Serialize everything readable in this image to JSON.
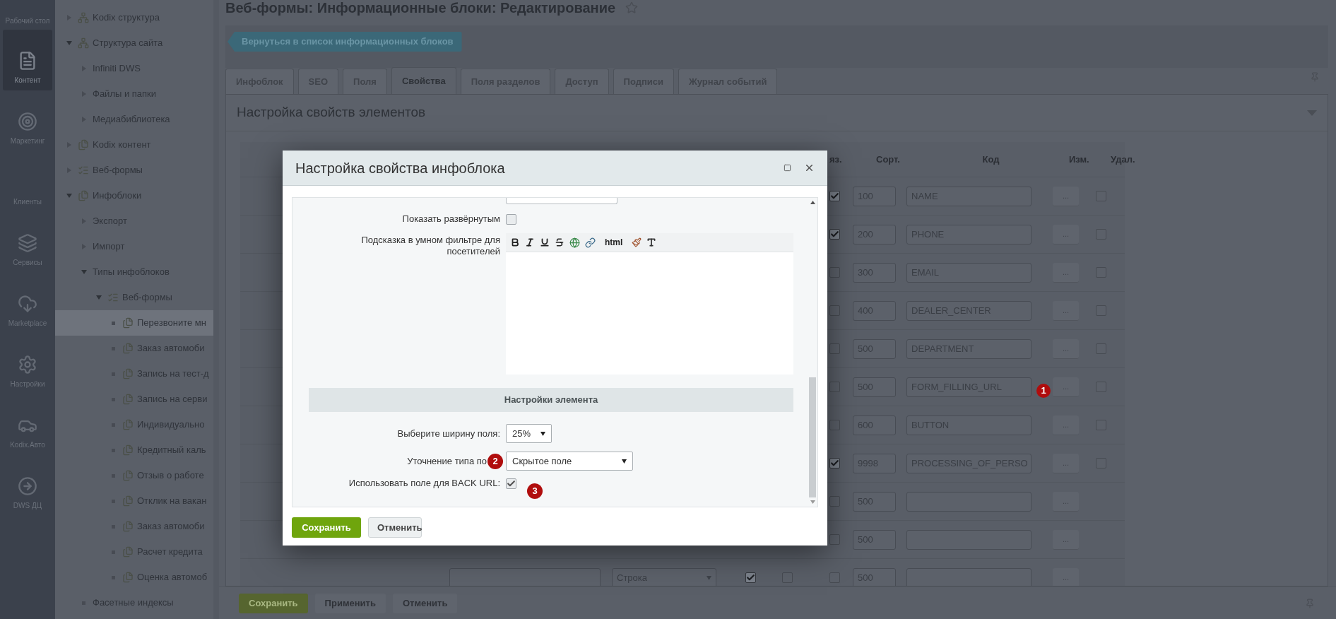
{
  "left_nav": [
    {
      "label": "Рабочий стол",
      "selected": false
    },
    {
      "label": "Контент",
      "selected": true
    },
    {
      "label": "Маркетинг",
      "selected": false
    },
    {
      "label": "Клиенты",
      "selected": false
    },
    {
      "label": "Сервисы",
      "selected": false
    },
    {
      "label": "Marketplace",
      "selected": false
    },
    {
      "label": "Настройки",
      "selected": false
    },
    {
      "label": "Kodix.Авто",
      "selected": false
    },
    {
      "label": "DWS ДЦ",
      "selected": false
    }
  ],
  "tree": [
    {
      "label": "Kodix структура",
      "kind": "branch",
      "expanded": false,
      "selected": false
    },
    {
      "label": "Структура сайта",
      "kind": "branch",
      "expanded": true,
      "selected": false,
      "children": [
        {
          "label": "Infiniti DWS",
          "kind": "branch",
          "expanded": false,
          "selected": false
        },
        {
          "label": "Файлы и папки",
          "kind": "branch",
          "expanded": false,
          "selected": false
        },
        {
          "label": "Медиабиблиотека",
          "kind": "branch",
          "expanded": false,
          "selected": false
        }
      ]
    },
    {
      "label": "Kodix контент",
      "kind": "branch",
      "expanded": false,
      "selected": false
    },
    {
      "label": "Веб-формы",
      "kind": "branch",
      "expanded": false,
      "selected": false
    },
    {
      "label": "Инфоблоки",
      "kind": "branch",
      "expanded": true,
      "selected": false,
      "children": [
        {
          "label": "Экспорт",
          "kind": "branch",
          "expanded": false,
          "selected": false
        },
        {
          "label": "Импорт",
          "kind": "branch",
          "expanded": false,
          "selected": false
        },
        {
          "label": "Типы инфоблоков",
          "kind": "branch",
          "expanded": true,
          "selected": false,
          "children": [
            {
              "label": "Веб-формы",
              "kind": "branch",
              "expanded": true,
              "selected": false,
              "children": [
                {
                  "label": "Перезвоните мн",
                  "kind": "leaf",
                  "selected": true
                },
                {
                  "label": "Заказ автомоби",
                  "kind": "leaf",
                  "selected": false
                },
                {
                  "label": "Запись на тест-д",
                  "kind": "leaf",
                  "selected": false
                },
                {
                  "label": "Запись на серви",
                  "kind": "leaf",
                  "selected": false
                },
                {
                  "label": "Индивидуально",
                  "kind": "leaf",
                  "selected": false
                },
                {
                  "label": "Кредитный каль",
                  "kind": "leaf",
                  "selected": false
                },
                {
                  "label": "Отзыв о работе",
                  "kind": "leaf",
                  "selected": false
                },
                {
                  "label": "Отклик на вакан",
                  "kind": "leaf",
                  "selected": false
                },
                {
                  "label": "Заказ автомоби",
                  "kind": "leaf",
                  "selected": false
                },
                {
                  "label": "Расчет кредита",
                  "kind": "leaf",
                  "selected": false
                },
                {
                  "label": "Оценка автомоб",
                  "kind": "leaf",
                  "selected": false
                }
              ]
            }
          ]
        },
        {
          "label": "Фасетные индексы",
          "kind": "leaf",
          "selected": false
        }
      ]
    }
  ],
  "page_title": "Веб-формы: Информационные блоки: Редактирование",
  "back_button": "Вернуться в список информационных блоков",
  "tabs": [
    {
      "label": "Инфоблок",
      "selected": false
    },
    {
      "label": "SEO",
      "selected": false
    },
    {
      "label": "Поля",
      "selected": false
    },
    {
      "label": "Свойства",
      "selected": true
    },
    {
      "label": "Поля разделов",
      "selected": false
    },
    {
      "label": "Доступ",
      "selected": false
    },
    {
      "label": "Подписи",
      "selected": false
    },
    {
      "label": "Журнал событий",
      "selected": false
    }
  ],
  "section_title": "Настройка свойств элементов",
  "table": {
    "columns": {
      "required": "яз.",
      "sort": "Сорт.",
      "code": "Код",
      "edit": "Изм.",
      "delete": "Удал."
    },
    "rows": [
      {
        "required": true,
        "sort": "100",
        "code": "NAME",
        "edit": "...",
        "delete": false
      },
      {
        "required": true,
        "sort": "200",
        "code": "PHONE",
        "edit": "...",
        "delete": false
      },
      {
        "required": false,
        "sort": "300",
        "code": "EMAIL",
        "edit": "...",
        "delete": false
      },
      {
        "required": false,
        "sort": "400",
        "code": "DEALER_CENTER",
        "edit": "...",
        "delete": false
      },
      {
        "required": false,
        "sort": "500",
        "code": "DEPARTMENT",
        "edit": "...",
        "delete": false
      },
      {
        "required": false,
        "sort": "500",
        "code": "FORM_FILLING_URL",
        "edit": "...",
        "delete": false
      },
      {
        "required": false,
        "sort": "600",
        "code": "BUTTON",
        "edit": "...",
        "delete": false
      },
      {
        "required": true,
        "sort": "9998",
        "code": "PROCESSING_OF_PERSO",
        "edit": "...",
        "delete": false
      },
      {
        "required": false,
        "sort": "500",
        "edit": "..."
      },
      {
        "required": false,
        "sort": "500",
        "edit": "..."
      },
      {
        "type": "Строка",
        "active": true,
        "multiple": false,
        "required": false,
        "sort": "500",
        "edit": "..."
      }
    ]
  },
  "bottom_buttons": [
    {
      "label": "Сохранить",
      "kind": "primary"
    },
    {
      "label": "Применить",
      "kind": "secondary"
    },
    {
      "label": "Отменить",
      "kind": "secondary"
    }
  ],
  "dialog": {
    "title": "Настройка свойства инфоблока",
    "rows": [
      {
        "kind": "checkbox",
        "label": "Показать развёрнутым",
        "checked": false
      },
      {
        "kind": "editor",
        "label": "Подсказка в умном фильтре для посетителей",
        "toolbar_text": "html"
      },
      {
        "kind": "section",
        "label": "Настройки элемента"
      },
      {
        "kind": "select",
        "label": "Выберите ширину поля:",
        "value": "25%"
      },
      {
        "kind": "select",
        "label": "Уточнение типа по",
        "value": "Скрытое поле"
      },
      {
        "kind": "checkbox",
        "label": "Использовать поле для BACK URL:",
        "checked": true
      }
    ],
    "buttons": [
      {
        "label": "Сохранить",
        "kind": "primary"
      },
      {
        "label": "Отменить",
        "kind": "secondary"
      }
    ]
  },
  "annotations": [
    "1",
    "2",
    "3"
  ]
}
